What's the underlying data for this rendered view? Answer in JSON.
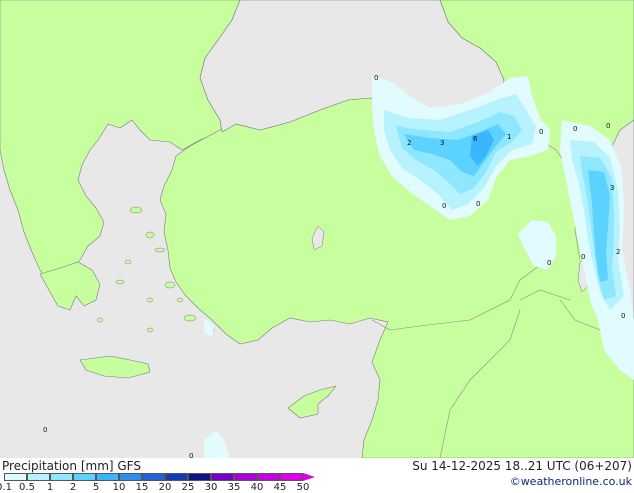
{
  "map": {
    "title": "Precipitation [mm] GFS",
    "datetime": "Su 14-12-2025 18..21 UTC (06+207)",
    "credit": "©weatheronline.co.uk",
    "colors": {
      "sea": "#e8e8e8",
      "land": "#c8ff9e",
      "border": "#7a7a7a"
    },
    "value_labels": [
      "0",
      "2",
      "3",
      "6",
      "1",
      "0",
      "0",
      "0",
      "0",
      "0",
      "3",
      "0",
      "2",
      "0",
      "0",
      "0",
      "0"
    ]
  },
  "legend": {
    "labels": [
      "0.1",
      "0.5",
      "1",
      "2",
      "5",
      "10",
      "15",
      "20",
      "25",
      "30",
      "35",
      "40",
      "45",
      "50"
    ],
    "colors": [
      "#e1fbff",
      "#b7f2ff",
      "#8ee6ff",
      "#5cd2ff",
      "#3ab6ff",
      "#2a8ff0",
      "#2063d8",
      "#1838b4",
      "#0c1688",
      "#7a00c8",
      "#a800d8",
      "#c800e0",
      "#e000e8"
    ]
  }
}
